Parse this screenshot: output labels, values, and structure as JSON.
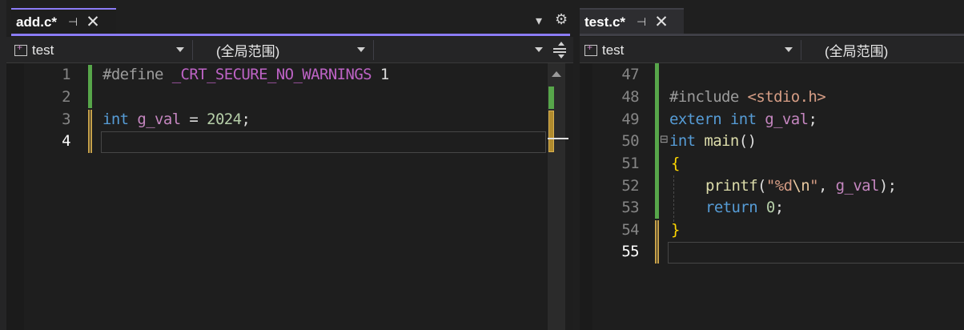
{
  "left_pane": {
    "tab": {
      "title": "add.c*",
      "pin": "⊣",
      "close": "✕"
    },
    "tab_actions": {
      "dropdown": "▾",
      "settings": "⚙"
    },
    "nav": {
      "project": "test",
      "scope": "(全局范围)",
      "member": ""
    },
    "lines": [
      {
        "number": "1"
      },
      {
        "number": "2"
      },
      {
        "number": "3"
      },
      {
        "number": "4"
      }
    ],
    "code": {
      "l1_directive": "#define",
      "l1_macro": " _CRT_SECURE_NO_WARNINGS",
      "l1_value": " 1",
      "l3_type": "int",
      "l3_var": " g_val",
      "l3_eq": " = ",
      "l3_num": "2024",
      "l3_semi": ";"
    }
  },
  "right_pane": {
    "tab": {
      "title": "test.c*",
      "pin": "⊣",
      "close": "✕"
    },
    "nav": {
      "project": "test",
      "scope": "(全局范围)"
    },
    "lines": [
      {
        "number": "47"
      },
      {
        "number": "48"
      },
      {
        "number": "49"
      },
      {
        "number": "50"
      },
      {
        "number": "51"
      },
      {
        "number": "52"
      },
      {
        "number": "53"
      },
      {
        "number": "54"
      },
      {
        "number": "55"
      }
    ],
    "code": {
      "l48_directive": "#include",
      "l48_header": " <stdio.h>",
      "l49_kw1": "extern",
      "l49_kw2": " int",
      "l49_var": " g_val",
      "l49_semi": ";",
      "l50_fold": "⊟",
      "l50_type": "int",
      "l50_fn": " main",
      "l50_paren": "()",
      "l51_brace": "{",
      "l52_fn": "printf",
      "l52_open": "(",
      "l52_str1": "\"%d",
      "l52_esc": "\\n",
      "l52_str2": "\"",
      "l52_comma": ", ",
      "l52_var": "g_val",
      "l52_close": ");",
      "l53_kw": "return",
      "l53_num": " 0",
      "l53_semi": ";",
      "l54_brace": "}"
    }
  },
  "colors": {
    "accent": "#8b7cf6",
    "background": "#1e1e1e",
    "keyword": "#569cd6",
    "function": "#dcdcaa",
    "variable": "#c586c0",
    "changed_saved": "#57a64a",
    "changed_unsaved": "#c8a24a"
  }
}
